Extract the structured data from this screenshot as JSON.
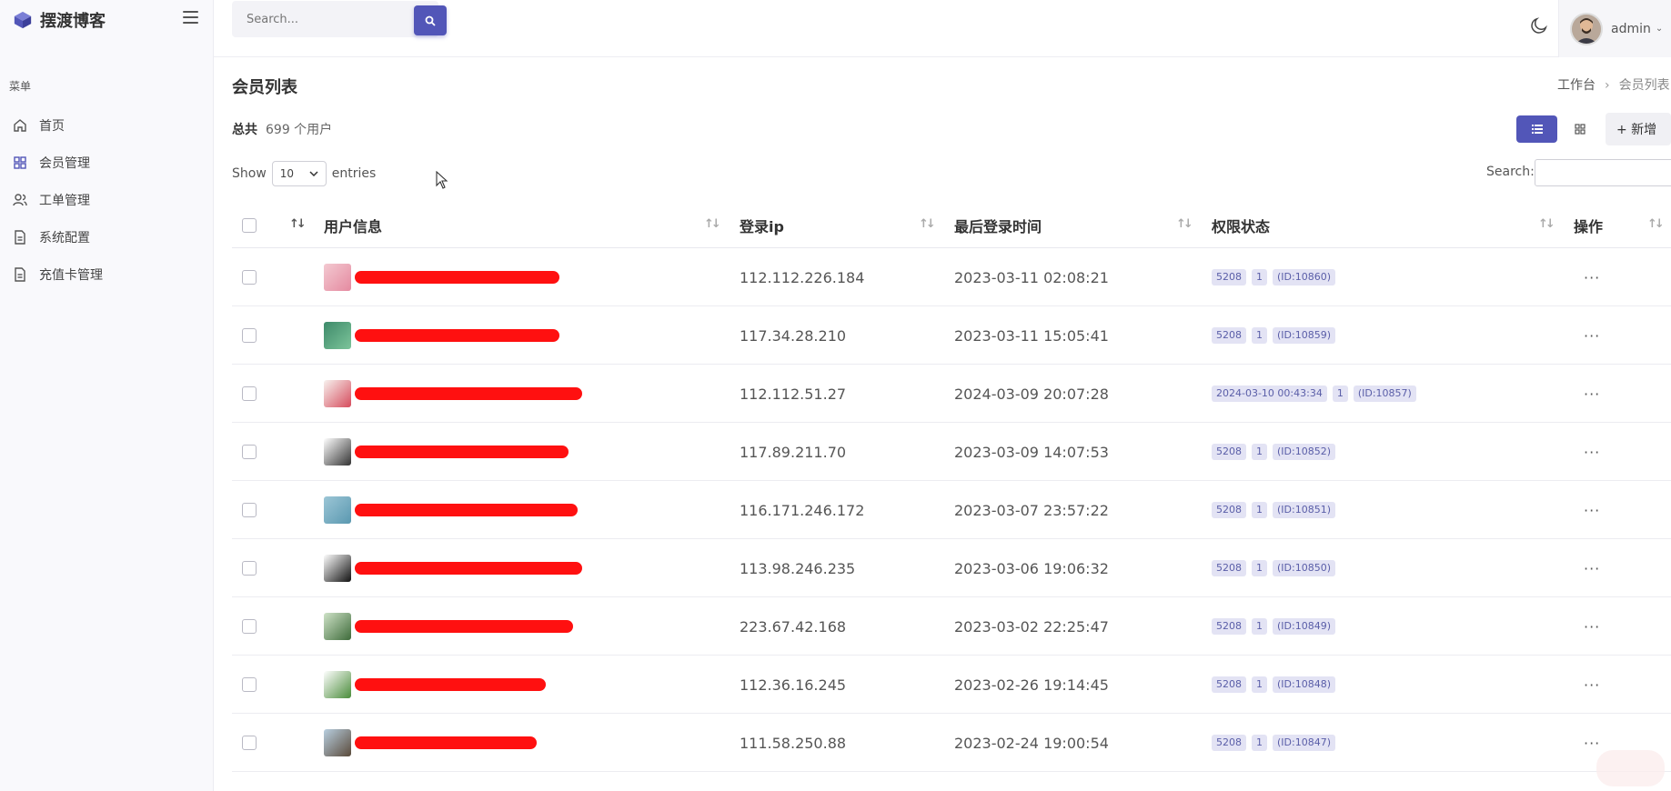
{
  "brand": {
    "name": "摆渡博客",
    "accent": "#5256b8"
  },
  "sidebar": {
    "menu_title": "菜单",
    "items": [
      {
        "label": "首页",
        "icon": "home-icon"
      },
      {
        "label": "会员管理",
        "icon": "grid-icon"
      },
      {
        "label": "工单管理",
        "icon": "users-icon"
      },
      {
        "label": "系统配置",
        "icon": "document-icon"
      },
      {
        "label": "充值卡管理",
        "icon": "document-icon"
      }
    ]
  },
  "topbar": {
    "search_placeholder": "Search...",
    "user_name": "admin"
  },
  "page": {
    "title": "会员列表",
    "breadcrumb": {
      "home": "工作台",
      "current": "会员列表"
    },
    "total_label": "总共",
    "total_count": "699 个用户",
    "add_label": "+ 新增"
  },
  "table_controls": {
    "show_label": "Show",
    "page_size": "10",
    "entries_label": "entries",
    "search_label": "Search:"
  },
  "table": {
    "columns": [
      "用户信息",
      "登录ip",
      "最后登录时间",
      "权限状态",
      "操作"
    ],
    "rows": [
      {
        "ip": "112.112.226.184",
        "time": "2023-03-11 02:08:21",
        "badges": [
          "5208",
          "1",
          "(ID:10860)"
        ]
      },
      {
        "ip": "117.34.28.210",
        "time": "2023-03-11 15:05:41",
        "badges": [
          "5208",
          "1",
          "(ID:10859)"
        ]
      },
      {
        "ip": "112.112.51.27",
        "time": "2024-03-09 20:07:28",
        "badges": [
          "2024-03-10 00:43:34",
          "1",
          "(ID:10857)"
        ]
      },
      {
        "ip": "117.89.211.70",
        "time": "2023-03-09 14:07:53",
        "badges": [
          "5208",
          "1",
          "(ID:10852)"
        ]
      },
      {
        "ip": "116.171.246.172",
        "time": "2023-03-07 23:57:22",
        "badges": [
          "5208",
          "1",
          "(ID:10851)"
        ]
      },
      {
        "ip": "113.98.246.235",
        "time": "2023-03-06 19:06:32",
        "badges": [
          "5208",
          "1",
          "(ID:10850)"
        ]
      },
      {
        "ip": "223.67.42.168",
        "time": "2023-03-02 22:25:47",
        "badges": [
          "5208",
          "1",
          "(ID:10849)"
        ]
      },
      {
        "ip": "112.36.16.245",
        "time": "2023-02-26 19:14:45",
        "badges": [
          "5208",
          "1",
          "(ID:10848)"
        ]
      },
      {
        "ip": "111.58.250.88",
        "time": "2023-02-24 19:00:54",
        "badges": [
          "5208",
          "1",
          "(ID:10847)"
        ]
      }
    ],
    "action_label": "···"
  }
}
